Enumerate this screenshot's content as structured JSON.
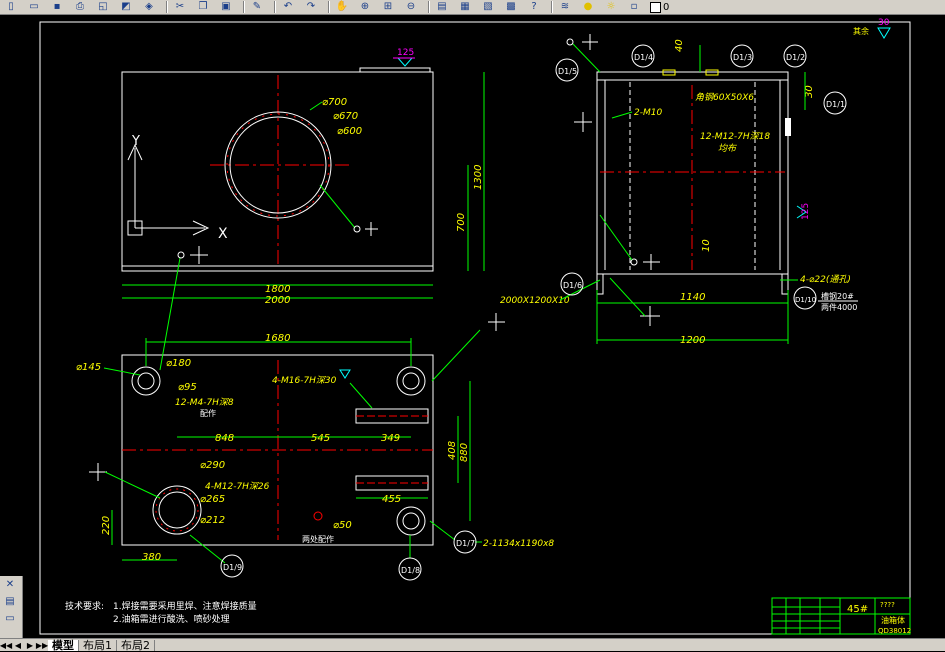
{
  "toolbar": {
    "icons": [
      "new-icon",
      "open-icon",
      "save-icon",
      "print-icon",
      "preview-icon",
      "publish-icon",
      "plot-icon",
      "cut-icon",
      "copy-icon",
      "paste-icon",
      "matchprop-icon",
      "undo-icon",
      "redo-icon",
      "pan-icon",
      "zoom-realtime-icon",
      "zoom-window-icon",
      "zoom-previous-icon",
      "properties-icon",
      "designcenter-icon",
      "toolpalette-icon",
      "calculator-icon",
      "help-icon",
      "layer-icon",
      "bulb-icon",
      "sun-icon",
      "lock-icon"
    ],
    "layer_name": "0"
  },
  "tabs": {
    "nav": [
      "◀◀",
      "◀",
      "▶",
      "▶▶"
    ],
    "items": [
      "模型",
      "布局1",
      "布局2"
    ],
    "active": "模型"
  },
  "drawing": {
    "top_view": {
      "dim_1800": "1800",
      "dim_2000": "2000",
      "dim_700": "700",
      "dim_1300": "1300",
      "phi700": "⌀700",
      "phi670": "⌀670",
      "phi600": "⌀600",
      "roughness_125": "125",
      "axis_x": "X",
      "axis_y": "Y"
    },
    "side_view": {
      "dim_40": "40",
      "dim_30": "30",
      "dim_10": "10",
      "dim_1140": "1140",
      "dim_1200": "1200",
      "angle_steel": "角钢60X50X6",
      "pipe_2m10": "2-M10",
      "bolts": "12-M12-7H深18",
      "even_dist": "均布",
      "holes_22": "4-⌀22(通孔)",
      "channel_steel": "槽钢20#",
      "two_pieces": "两件4000",
      "plate": "2000X1200X10",
      "roughness_125": "125",
      "roughness_30": "30",
      "other": "其余"
    },
    "bottom_view": {
      "dim_1680": "1680",
      "dim_848": "848",
      "dim_545": "545",
      "dim_349": "349",
      "dim_408": "408",
      "dim_880": "880",
      "dim_455": "455",
      "dim_380": "380",
      "dim_220": "220",
      "phi145": "⌀145",
      "phi180": "⌀180",
      "phi95": "⌀95",
      "m4": "12-M4-7H深8",
      "peizuo": "配作",
      "m16": "4-M16-7H深30",
      "phi290": "⌀290",
      "m12": "4-M12-7H深26",
      "phi265": "⌀265",
      "phi212": "⌀212",
      "phi50": "⌀50",
      "outlet": "两处配作",
      "slot": "2-1134x1190x8"
    },
    "callouts": [
      "D1/1",
      "D1/2",
      "D1/3",
      "D1/4",
      "D1/5",
      "D1/6",
      "D1/7",
      "D1/8",
      "D1/9",
      "D1/10"
    ],
    "notes": {
      "title": "技术要求:",
      "line1": "1.焊接需要采用里焊、注意焊接质量",
      "line2": "2.油箱需进行酸洗、喷砂处理"
    },
    "title_block": {
      "part_no": "45#",
      "name": "油箱体",
      "code": "????",
      "drawing_no": "QD38012"
    }
  },
  "colors": {
    "background": "#000000",
    "outline": "#ffffff",
    "dimension": "#00ff00",
    "text": "#ffff00",
    "centerline": "#ff0000",
    "hidden": "#ff00ff",
    "accent": "#00ffff"
  }
}
